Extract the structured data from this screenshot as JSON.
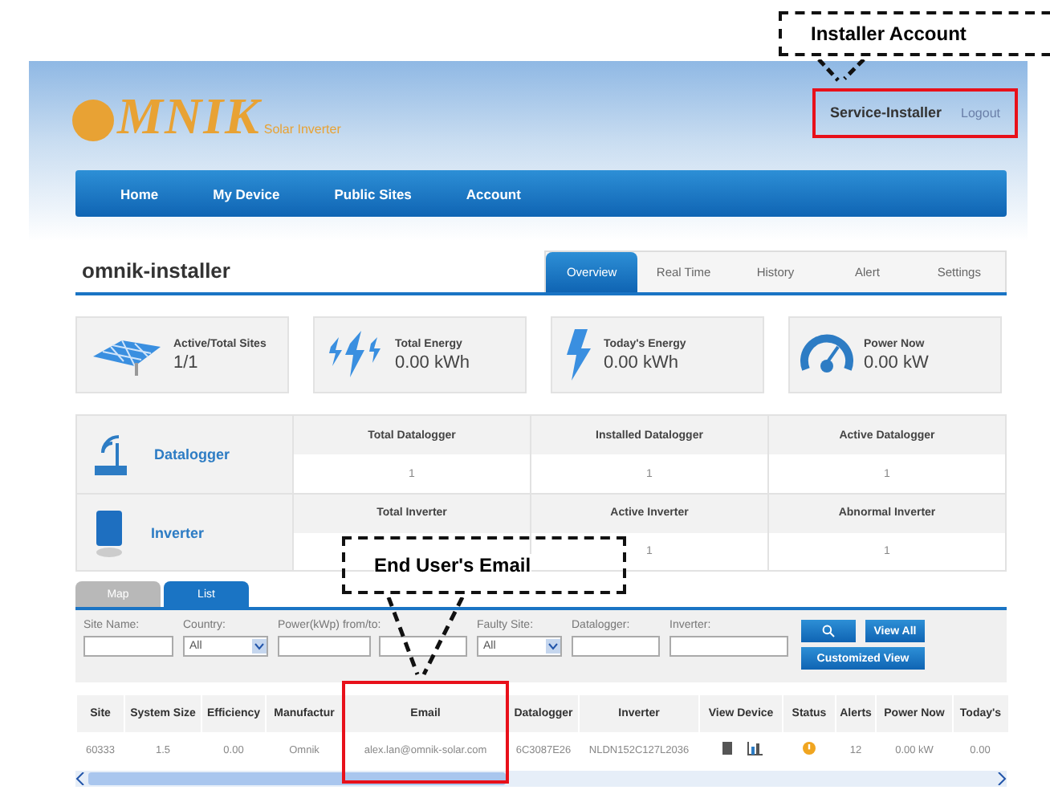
{
  "logo": {
    "name": "MNIK",
    "tagline": "Solar Inverter"
  },
  "user": {
    "name": "Service-Installer",
    "logout": "Logout"
  },
  "nav": [
    "Home",
    "My Device",
    "Public Sites",
    "Account"
  ],
  "page_title": "omnik-installer",
  "tabs": [
    {
      "label": "Overview",
      "selected": true
    },
    {
      "label": "Real Time",
      "selected": false
    },
    {
      "label": "History",
      "selected": false
    },
    {
      "label": "Alert",
      "selected": false
    },
    {
      "label": "Settings",
      "selected": false
    }
  ],
  "stats": [
    {
      "kind": "sites",
      "label": "Active/Total Sites",
      "value": "1/1"
    },
    {
      "kind": "energy",
      "label": "Total Energy",
      "value": "0.00 kWh"
    },
    {
      "kind": "today",
      "label": "Today's Energy",
      "value": "0.00 kWh"
    },
    {
      "kind": "power",
      "label": "Power Now",
      "value": "0.00 kW"
    }
  ],
  "devices": [
    {
      "kind": "datalogger",
      "name": "Datalogger",
      "stats": [
        {
          "label": "Total Datalogger",
          "value": "1"
        },
        {
          "label": "Installed Datalogger",
          "value": "1"
        },
        {
          "label": "Active Datalogger",
          "value": "1"
        }
      ]
    },
    {
      "kind": "inverter",
      "name": "Inverter",
      "stats": [
        {
          "label": "Total Inverter"
        },
        {
          "label": "Active Inverter",
          "value": "1"
        },
        {
          "label": "Abnormal Inverter",
          "value": "1"
        }
      ]
    }
  ],
  "view_tabs": [
    {
      "label": "Map",
      "selected": false
    },
    {
      "label": "List",
      "selected": true
    }
  ],
  "filters": [
    {
      "kind": "input",
      "label": "Site Name:"
    },
    {
      "kind": "select",
      "label": "Country:",
      "value": "All"
    },
    {
      "kind": "range",
      "label": "Power(kWp) from/to:"
    },
    {
      "kind": "select",
      "label": "Faulty Site:",
      "value": "All"
    },
    {
      "kind": "input",
      "label": "Datalogger:"
    },
    {
      "kind": "input",
      "label": "Inverter:"
    }
  ],
  "buttons": {
    "view_all": "View All",
    "customized": "Customized View"
  },
  "table": {
    "columns": [
      "Site",
      "System Size",
      "Efficiency",
      "Manufactur",
      "Email",
      "Datalogger",
      "Inverter",
      "View Device",
      "Status",
      "Alerts",
      "Power Now",
      "Today's"
    ],
    "rows": [
      [
        "60333",
        "1.5",
        "0.00",
        "Omnik",
        "alex.lan@omnik-solar.com",
        "6C3087E26",
        "NLDN152C127L2036",
        null,
        null,
        "12",
        "0.00 kW",
        "0.00"
      ]
    ]
  },
  "annotations": [
    {
      "text": "Installer Account"
    },
    {
      "text": "End User's Email"
    }
  ]
}
